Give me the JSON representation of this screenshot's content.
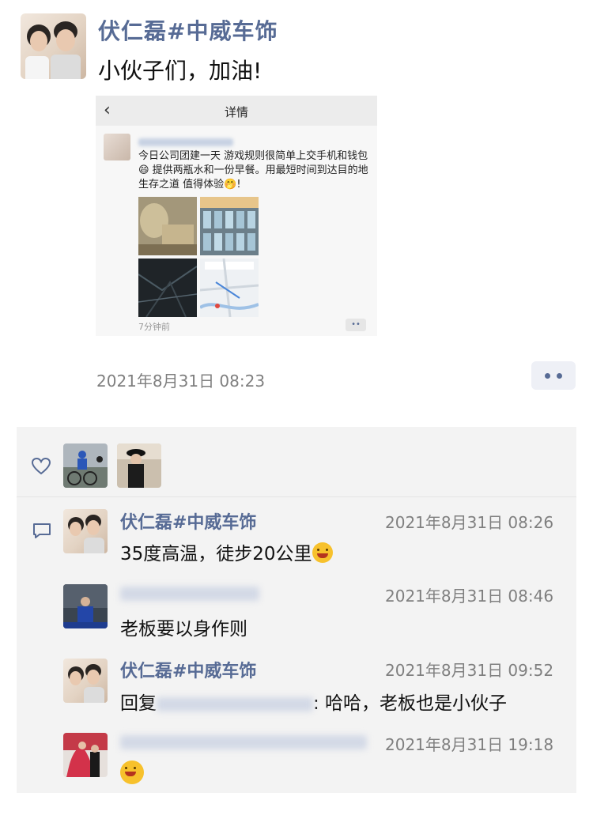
{
  "post": {
    "author": "伏仁磊#中威车饰",
    "text": "小伙子们，加油!",
    "time": "2021年8月31日 08:23",
    "shared": {
      "header_title": "详情",
      "body": "今日公司团建一天  游戏规则很简单上交手机和钱包😄   提供两瓶水和一份早餐。用最短时间到达目的地  生存之道  值得体验🤭!",
      "posted_ago": "7分钟前",
      "more": "••"
    }
  },
  "comments": [
    {
      "author": "伏仁磊#中威车饰",
      "time": "2021年8月31日 08:26",
      "text_before": "35度高温，徒步20公里"
    },
    {
      "author": "",
      "time": "2021年8月31日 08:46",
      "text_before": "老板要以身作则"
    },
    {
      "author": "伏仁磊#中威车饰",
      "time": "2021年8月31日 09:52",
      "reply_label": "回复",
      "text_after": ": 哈哈，老板也是小伙子"
    },
    {
      "author": "",
      "time": "2021年8月31日 19:18"
    }
  ],
  "icons": {
    "like": "heart-icon",
    "comment": "comment-bubble-icon",
    "back": "chevron-left-icon",
    "more": "more-dots-icon"
  },
  "colors": {
    "name_blue": "#576b95",
    "panel_bg": "#f3f3f3",
    "time_gray": "#7f7f7f"
  }
}
